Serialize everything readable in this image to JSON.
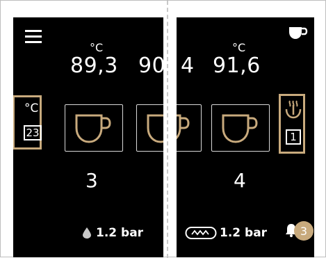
{
  "colors": {
    "panel_bg": "#000000",
    "accent_gold": "#c8aa7d",
    "cup_gold": "#c8aa7d",
    "text": "#ffffff"
  },
  "icons": {
    "menu": "hamburger-menu-icon",
    "cup_top": "coffee-cup-icon",
    "cup_button": "coffee-cup-icon",
    "drop": "water-drop-icon",
    "steam_wand": "steam-wand-icon",
    "heater": "heating-element-icon",
    "bell": "bell-icon"
  },
  "left_screen": {
    "temp_unit": "°C",
    "temperature": "89,3",
    "temp_partial": "90",
    "side_button": {
      "unit": "°C",
      "value": "23"
    },
    "cup_count": "3",
    "pressure": "1.2 bar"
  },
  "right_screen": {
    "temp_unit": "°C",
    "temp_partial": "4",
    "temperature": "91,6",
    "side_button": {
      "value": "1"
    },
    "cup_count": "4",
    "pressure": "1.2 bar",
    "notification_count": "3"
  }
}
